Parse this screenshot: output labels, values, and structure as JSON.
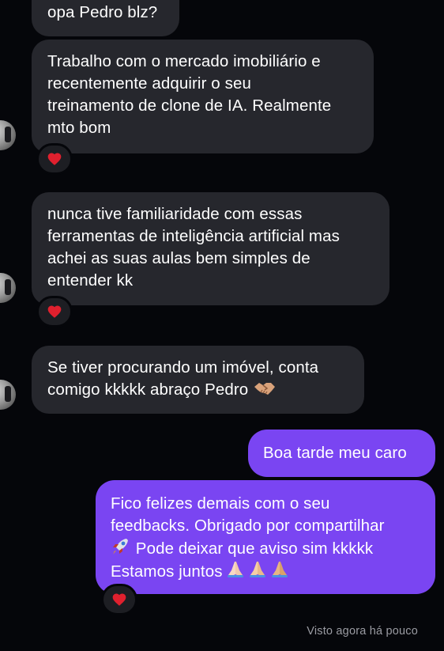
{
  "messages": [
    {
      "id": "m1",
      "from": "contact",
      "lines": [
        "opa Pedro blz?"
      ]
    },
    {
      "id": "m2",
      "from": "contact",
      "lines": [
        "Trabalho com o mercado imobiliário e",
        "recentemente adquirir o seu",
        "treinamento de clone de IA. Realmente",
        "mto bom"
      ],
      "reaction": "heart"
    },
    {
      "id": "m3",
      "from": "contact",
      "lines": [
        "nunca tive familiaridade com essas",
        "ferramentas de inteligência artificial mas",
        "achei as suas aulas bem simples de",
        "entender kk"
      ],
      "reaction": "heart"
    },
    {
      "id": "m4",
      "from": "contact",
      "lines": [
        "Se tiver procurando um imóvel, conta",
        "comigo kkkkk abraço Pedro"
      ],
      "trailing_emoji": "handshake"
    },
    {
      "id": "m5",
      "from": "me",
      "lines": [
        "Boa tarde meu caro"
      ]
    },
    {
      "id": "m6",
      "from": "me",
      "lines": [
        "Fico felizes demais com o seu",
        "feedbacks. Obrigado por compartilhar",
        " Pode deixar que aviso sim kkkkk",
        "Estamos juntos"
      ],
      "emojis": [
        "rocket",
        "folded-hands",
        "folded-hands",
        "folded-hands"
      ],
      "reaction": "heart"
    }
  ],
  "seen_status": "Visto agora há pouco",
  "colors": {
    "background": "#05060a",
    "incoming_bubble": "#26272d",
    "outgoing_bubble": "#7a45f2",
    "heart": "#e0202e",
    "seen_text": "#9a9ba2"
  }
}
